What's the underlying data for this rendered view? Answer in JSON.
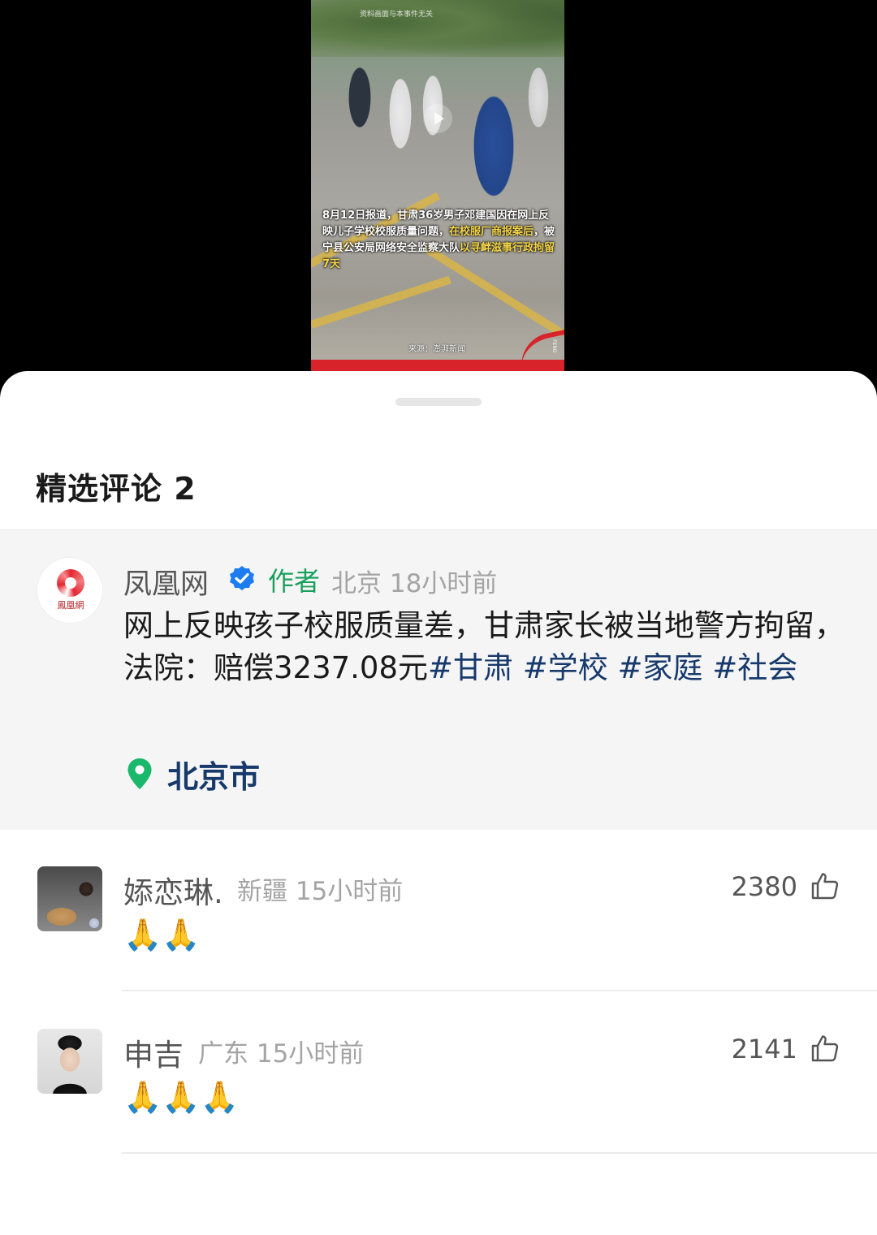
{
  "video": {
    "top_note": "资料画面与本事件无关",
    "caption_white_1": "8月12日报道，甘肃36岁男子邓建国因在网上反映儿子学校校服质量问题，",
    "caption_highlight_1": "在校服厂商报案后",
    "caption_white_2": "，被宁县公安局网络安全监察大队",
    "caption_highlight_2": "以寻衅滋事行政拘留7天",
    "source": "来源：澎湃新闻",
    "brand_vertical": "FENG"
  },
  "sheet": {
    "title": "精选评论 2"
  },
  "author_comment": {
    "avatar_text": "鳳凰網",
    "name": "凤凰网",
    "author_tag": "作者",
    "meta": "北京 18小时前",
    "text_main": "网上反映孩子校服质量差，甘肃家长被当地警方拘留，法院：赔偿3237.08元",
    "hashtags": "#甘肃 #学校 #家庭 #社会",
    "location": "北京市",
    "colors": {
      "author_tag": "#19a05c",
      "link": "#17396b",
      "verified": "#1d7cf2"
    }
  },
  "comments": [
    {
      "name": "婖恋琳.",
      "meta": "新疆 15小时前",
      "likes": "2380",
      "emoji": "🙏🙏"
    },
    {
      "name": "申吉",
      "meta": "广东 15小时前",
      "likes": "2141",
      "emoji": "🙏🙏🙏"
    }
  ]
}
